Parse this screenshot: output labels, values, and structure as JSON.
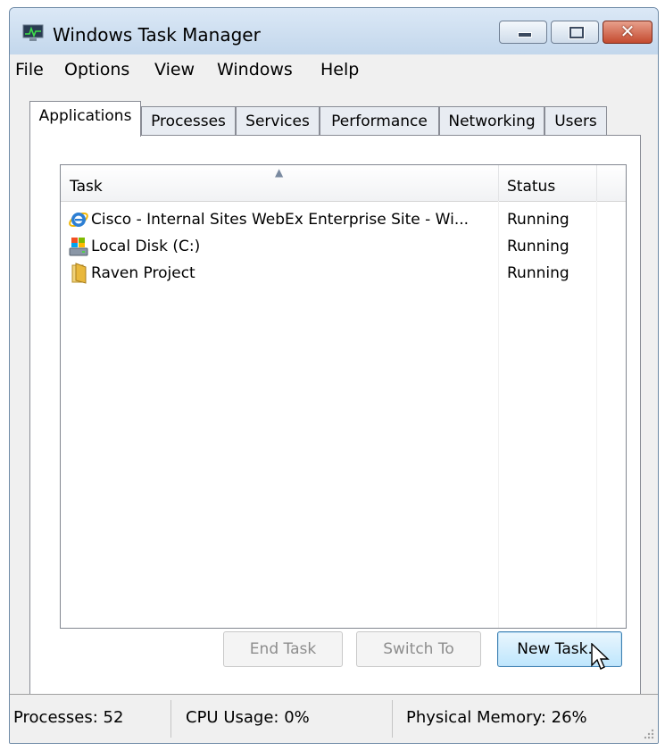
{
  "window": {
    "title": "Windows Task Manager"
  },
  "menu": [
    "File",
    "Options",
    "View",
    "Windows",
    "Help"
  ],
  "tabs": [
    "Applications",
    "Processes",
    "Services",
    "Performance",
    "Networking",
    "Users"
  ],
  "active_tab": "Applications",
  "list": {
    "columns": {
      "task": "Task",
      "status": "Status"
    },
    "rows": [
      {
        "task": "Cisco - Internal Sites WebEx Enterprise Site - Wi...",
        "status": "Running",
        "icon": "internet-explorer-icon"
      },
      {
        "task": "Local Disk (C:)",
        "status": "Running",
        "icon": "local-disk-icon"
      },
      {
        "task": "Raven Project",
        "status": "Running",
        "icon": "folder-icon"
      }
    ]
  },
  "buttons": {
    "end_task": "End Task",
    "switch_to": "Switch To",
    "new_task": "New Task..."
  },
  "status": {
    "processes": "Processes: 52",
    "cpu": "CPU Usage: 0%",
    "memory": "Physical Memory: 26%"
  },
  "colors": {
    "title_bar": "#c3d7ec",
    "close_button": "#c44a2f",
    "focus_button": "#bee6fd"
  }
}
